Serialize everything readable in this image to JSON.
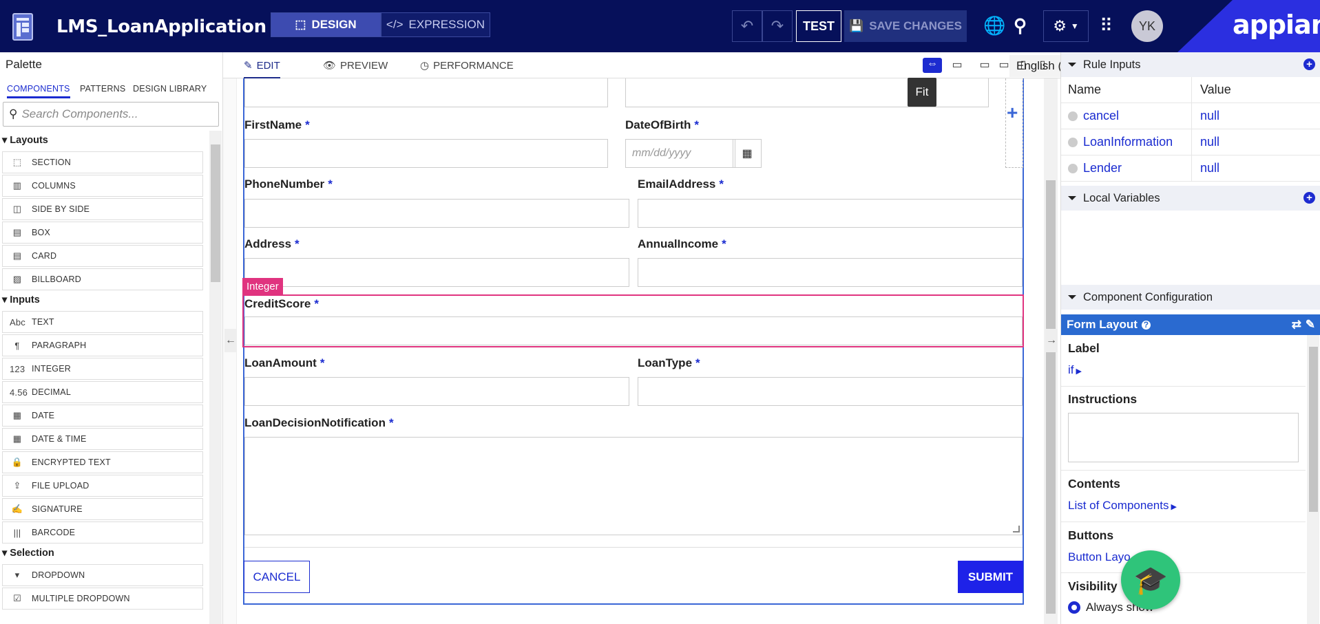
{
  "header": {
    "app_title": "LMS_LoanApplication",
    "design_label": "DESIGN",
    "expression_label": "EXPRESSION",
    "test_label": "TEST",
    "save_label": "SAVE CHANGES",
    "avatar_initials": "YK",
    "logo_text": "appian"
  },
  "palette": {
    "title": "Palette",
    "tabs": [
      "COMPONENTS",
      "PATTERNS",
      "DESIGN LIBRARY"
    ],
    "search_placeholder": "Search Components...",
    "sections": [
      {
        "title": "Layouts",
        "items": [
          {
            "icon": "section-icon",
            "glyph": "⬚",
            "label": "SECTION"
          },
          {
            "icon": "columns-icon",
            "glyph": "▥",
            "label": "COLUMNS"
          },
          {
            "icon": "side-by-side-icon",
            "glyph": "◫",
            "label": "SIDE BY SIDE"
          },
          {
            "icon": "box-icon",
            "glyph": "▤",
            "label": "BOX"
          },
          {
            "icon": "card-icon",
            "glyph": "▤",
            "label": "CARD"
          },
          {
            "icon": "billboard-icon",
            "glyph": "▨",
            "label": "BILLBOARD"
          }
        ]
      },
      {
        "title": "Inputs",
        "items": [
          {
            "icon": "text-icon",
            "glyph": "Abc",
            "label": "TEXT"
          },
          {
            "icon": "paragraph-icon",
            "glyph": "¶",
            "label": "PARAGRAPH"
          },
          {
            "icon": "integer-icon",
            "glyph": "123",
            "label": "INTEGER"
          },
          {
            "icon": "decimal-icon",
            "glyph": "4.56",
            "label": "DECIMAL"
          },
          {
            "icon": "date-icon",
            "glyph": "▦",
            "label": "DATE"
          },
          {
            "icon": "date-time-icon",
            "glyph": "▦",
            "label": "DATE & TIME"
          },
          {
            "icon": "lock-icon",
            "glyph": "🔒",
            "label": "ENCRYPTED TEXT"
          },
          {
            "icon": "upload-icon",
            "glyph": "⇪",
            "label": "FILE UPLOAD"
          },
          {
            "icon": "signature-icon",
            "glyph": "✍",
            "label": "SIGNATURE"
          },
          {
            "icon": "barcode-icon",
            "glyph": "|||",
            "label": "BARCODE"
          }
        ]
      },
      {
        "title": "Selection",
        "items": [
          {
            "icon": "dropdown-icon",
            "glyph": "▾",
            "label": "DROPDOWN"
          },
          {
            "icon": "multiple-dropdown-icon",
            "glyph": "☑",
            "label": "MULTIPLE DROPDOWN"
          }
        ]
      }
    ]
  },
  "editor": {
    "tabs": {
      "edit": "EDIT",
      "preview": "PREVIEW",
      "performance": "PERFORMANCE"
    },
    "language": "English (US) [...",
    "tooltip": "Fit",
    "selected_type_tag": "Integer",
    "fields": {
      "first_name": "FirstName",
      "date_of_birth": "DateOfBirth",
      "date_placeholder": "mm/dd/yyyy",
      "phone_number": "PhoneNumber",
      "email_address": "EmailAddress",
      "address": "Address",
      "annual_income": "AnnualIncome",
      "credit_score": "CreditScore",
      "loan_amount": "LoanAmount",
      "loan_type": "LoanType",
      "loan_decision": "LoanDecisionNotification"
    },
    "required_marker": "*",
    "cancel_label": "CANCEL",
    "submit_label": "SUBMIT"
  },
  "right_panel": {
    "rule_inputs_title": "Rule Inputs",
    "col_name": "Name",
    "col_value": "Value",
    "rule_inputs": [
      {
        "name": "cancel",
        "value": "null"
      },
      {
        "name": "LoanInformation",
        "value": "null"
      },
      {
        "name": "Lender",
        "value": "null"
      }
    ],
    "local_vars_title": "Local Variables",
    "component_config_title": "Component Configuration",
    "form_layout_label": "Form Layout",
    "label_title": "Label",
    "label_value": "if",
    "instructions_title": "Instructions",
    "contents_title": "Contents",
    "contents_value": "List of Components",
    "buttons_title": "Buttons",
    "buttons_value": "Button Layo",
    "visibility_title": "Visibility",
    "visibility_value": "Always show"
  },
  "colors": {
    "topbar": "#06105a",
    "accent": "#1a2bd0",
    "selection": "#e0337f",
    "fab": "#2fc47a"
  }
}
